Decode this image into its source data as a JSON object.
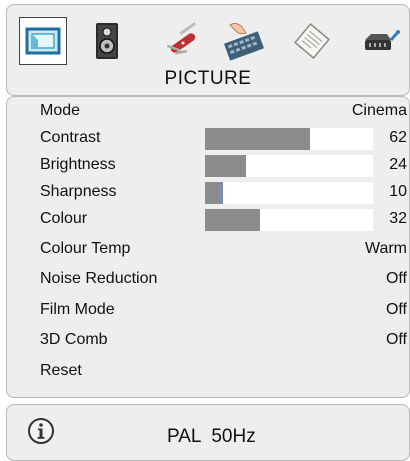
{
  "header": {
    "title": "PICTURE",
    "tabs": [
      {
        "name": "picture-tab",
        "icon": "picture-icon",
        "selected": true
      },
      {
        "name": "sound-tab",
        "icon": "speaker-icon",
        "selected": false
      },
      {
        "name": "settings-tab",
        "icon": "knife-tools-icon",
        "selected": false
      },
      {
        "name": "feature-tab",
        "icon": "hand-keyboard-icon",
        "selected": false
      },
      {
        "name": "guide-tab",
        "icon": "document-icon",
        "selected": false
      },
      {
        "name": "channel-tab",
        "icon": "satellite-icon",
        "selected": false
      }
    ]
  },
  "menu": {
    "items": [
      {
        "label": "Mode",
        "value": "Cinema"
      },
      {
        "label": "Contrast",
        "value": "62",
        "level": 0.62
      },
      {
        "label": "Brightness",
        "value": "24",
        "level": 0.24
      },
      {
        "label": "Sharpness",
        "value": "10",
        "level": 0.1
      },
      {
        "label": "Colour",
        "value": "32",
        "level": 0.32
      },
      {
        "label": "Colour Temp",
        "value": "Warm"
      },
      {
        "label": "Noise Reduction",
        "value": "Off"
      },
      {
        "label": "Film Mode",
        "value": "Off"
      },
      {
        "label": "3D Comb",
        "value": "Off"
      },
      {
        "label": "Reset",
        "value": ""
      }
    ]
  },
  "footer": {
    "info_icon": "info-icon",
    "signal": "PAL  50Hz"
  },
  "colors": {
    "bar_fill": "#8c8c8c",
    "bar_edge": "#6a8fd0",
    "panel_bg": "#eeeeee"
  }
}
